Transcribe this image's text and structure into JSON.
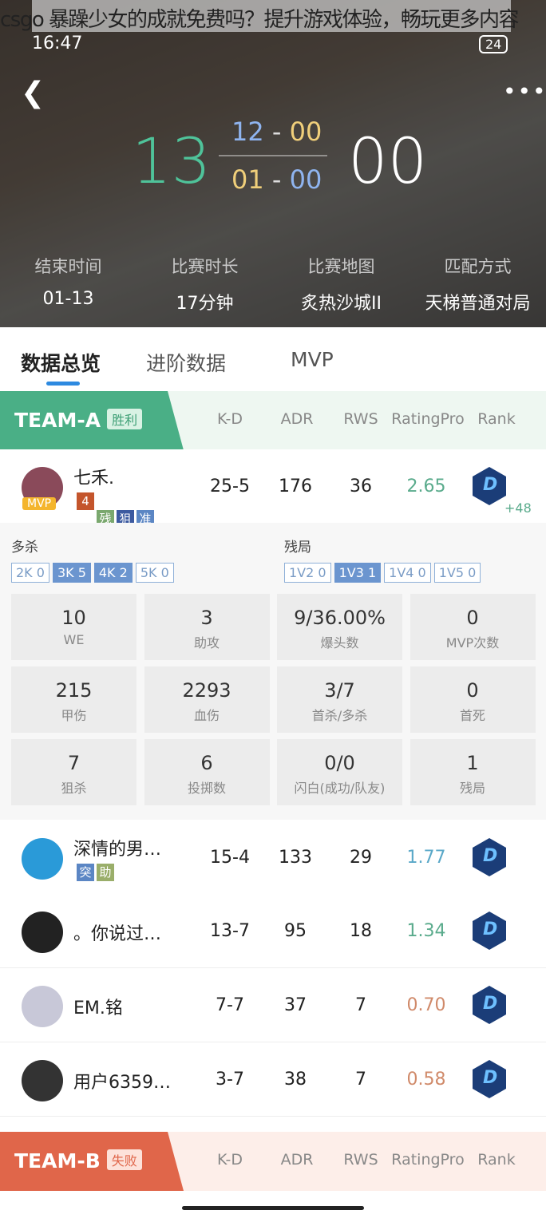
{
  "watermark": "csgo 暴躁少女的成就免费吗？提升游戏体验，畅玩更多内容",
  "status": {
    "time": "16:47",
    "battery": "24"
  },
  "icons": {
    "back": "chevron-left-icon",
    "more": "more-dots-icon",
    "rank": "rank-badge-icon"
  },
  "score": {
    "team_a": "13",
    "team_b": "00",
    "half1_a": "12",
    "half1_b": "00",
    "half2_a": "01",
    "half2_b": "00",
    "sep": "-"
  },
  "info": [
    {
      "label": "结束时间",
      "value": "01-13"
    },
    {
      "label": "比赛时长",
      "value": "17分钟"
    },
    {
      "label": "比赛地图",
      "value": "炙热沙城II"
    },
    {
      "label": "匹配方式",
      "value": "天梯普通对局"
    }
  ],
  "tabs": [
    {
      "label": "数据总览"
    },
    {
      "label": "进阶数据"
    },
    {
      "label": "MVP"
    }
  ],
  "columns": [
    "K-D",
    "ADR",
    "RWS",
    "RatingPro",
    "Rank"
  ],
  "team_a": {
    "name": "TEAM-A",
    "result": "胜利",
    "color": "#4aaf86"
  },
  "team_b": {
    "name": "TEAM-B",
    "result": "失败",
    "color": "#e0664a"
  },
  "players": [
    {
      "name": "七禾.",
      "kd": "25-5",
      "adr": "176",
      "rws": "36",
      "rating": "2.65",
      "rating_color": "#5aab8c",
      "mvp": "MVP",
      "rank_delta": "+48",
      "tags": [
        {
          "t": "4杀",
          "c": "#c4552c"
        },
        {
          "t": "残",
          "c": "#7aa86e"
        },
        {
          "t": "狙",
          "c": "#3c5aa0"
        },
        {
          "t": "准",
          "c": "#5b86c4"
        }
      ],
      "avatar": "#8a4a5a"
    },
    {
      "name": "深情的男…",
      "kd": "15-4",
      "adr": "133",
      "rws": "29",
      "rating": "1.77",
      "rating_color": "#5aa8c8",
      "tags": [
        {
          "t": "突",
          "c": "#5b86c4"
        },
        {
          "t": "助",
          "c": "#9aae6a"
        }
      ],
      "avatar": "#2a9ad8"
    },
    {
      "name": "。你说过…",
      "kd": "13-7",
      "adr": "95",
      "rws": "18",
      "rating": "1.34",
      "rating_color": "#5aab8c",
      "tags": [],
      "avatar": "#222"
    },
    {
      "name": "EM.铭",
      "kd": "7-7",
      "adr": "37",
      "rws": "7",
      "rating": "0.70",
      "rating_color": "#d08a6a",
      "tags": [],
      "avatar": "#c8c8d8"
    },
    {
      "name": "用户6359…",
      "kd": "3-7",
      "adr": "38",
      "rws": "7",
      "rating": "0.58",
      "rating_color": "#d08a6a",
      "tags": [],
      "avatar": "#333"
    }
  ],
  "details": {
    "multikill_label": "多杀",
    "clutch_label": "残局",
    "multikill": [
      {
        "t": "2K 0",
        "on": false
      },
      {
        "t": "3K 5",
        "on": true
      },
      {
        "t": "4K 2",
        "on": true
      },
      {
        "t": "5K 0",
        "on": false
      }
    ],
    "clutch": [
      {
        "t": "1V2 0",
        "on": false
      },
      {
        "t": "1V3 1",
        "on": true
      },
      {
        "t": "1V4 0",
        "on": false
      },
      {
        "t": "1V5 0",
        "on": false
      }
    ],
    "stats": [
      {
        "v": "10",
        "l": "WE"
      },
      {
        "v": "3",
        "l": "助攻"
      },
      {
        "v": "9/36.00%",
        "l": "爆头数"
      },
      {
        "v": "0",
        "l": "MVP次数"
      },
      {
        "v": "215",
        "l": "甲伤"
      },
      {
        "v": "2293",
        "l": "血伤"
      },
      {
        "v": "3/7",
        "l": "首杀/多杀"
      },
      {
        "v": "0",
        "l": "首死"
      },
      {
        "v": "7",
        "l": "狙杀"
      },
      {
        "v": "6",
        "l": "投掷数"
      },
      {
        "v": "0/0",
        "l": "闪白(成功/队友)"
      },
      {
        "v": "1",
        "l": "残局"
      }
    ]
  }
}
